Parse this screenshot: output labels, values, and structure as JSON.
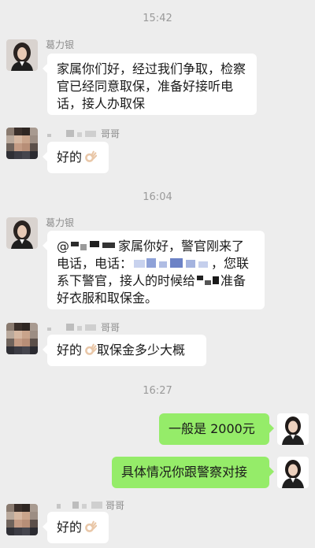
{
  "timestamps": [
    "15:42",
    "16:04",
    "16:27"
  ],
  "contacts": {
    "lawyer": {
      "name": "葛力银",
      "avatar_icon": "woman-portrait-avatar"
    },
    "family": {
      "name_suffix": "哥哥",
      "avatar_icon": "pixelated-avatar"
    },
    "self": {
      "avatar_icon": "woman-portrait-avatar"
    }
  },
  "messages": [
    {
      "from": "lawyer",
      "text": "家属你们好，经过我们争取，检察官已经同意取保，准备好接听电话，接人办取保"
    },
    {
      "from": "family",
      "text": "好的",
      "emoji": "ok-hand-emoji"
    },
    {
      "from": "lawyer",
      "parts": [
        "@",
        "家属你好，警官刚来了电话，电话：",
        "，您联系下警官，接人的时候给",
        "准备好衣服和取保金。"
      ]
    },
    {
      "from": "family",
      "text": "好的",
      "emoji": "ok-hand-emoji",
      "text_after": "取保金多少大概"
    },
    {
      "from": "self",
      "text": "一般是 2000元"
    },
    {
      "from": "self",
      "text": "具体情况你跟警察对接"
    },
    {
      "from": "family",
      "text": "好的",
      "emoji": "ok-hand-emoji"
    }
  ],
  "colors": {
    "background": "#ededed",
    "incoming_bubble": "#ffffff",
    "outgoing_bubble": "#95ec69",
    "name_text": "#8c8c8c"
  }
}
